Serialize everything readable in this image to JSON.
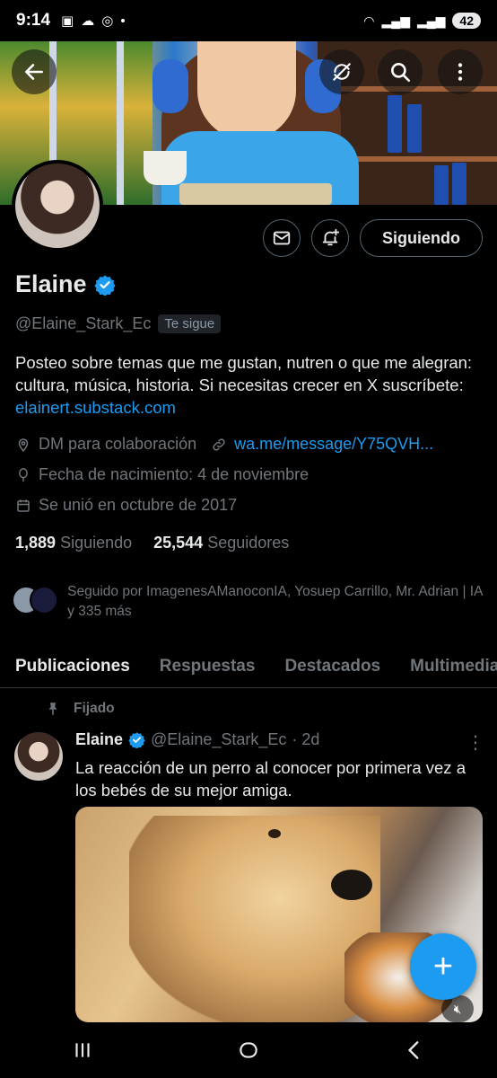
{
  "status_bar": {
    "time": "9:14",
    "battery": "42"
  },
  "profile": {
    "name": "Elaine",
    "handle": "@Elaine_Stark_Ec",
    "follows_you": "Te sigue",
    "follow_button": "Siguiendo",
    "bio_text": "Posteo sobre temas que me gustan, nutren o que me alegran: cultura, música, historia. Si necesitas crecer en X suscríbete: ",
    "bio_link": "elainert.substack.com",
    "location": "DM para colaboración",
    "website": "wa.me/message/Y75QVH...",
    "birthday": "Fecha de nacimiento: 4 de noviembre",
    "joined": "Se unió en octubre de 2017",
    "following_count": "1,889",
    "following_label": "Siguiendo",
    "followers_count": "25,544",
    "followers_label": "Seguidores",
    "followed_by": "Seguido por ImagenesAManoconIA, Yosuep Carrillo, Mr. Adrian | IA y 335 más"
  },
  "tabs": [
    "Publicaciones",
    "Respuestas",
    "Destacados",
    "Multimedia"
  ],
  "post": {
    "pinned_label": "Fijado",
    "author": "Elaine",
    "handle": "@Elaine_Stark_Ec",
    "time": "· 2d",
    "text": "La reacción de un perro al conocer por primera vez a los bebés de su mejor amiga."
  },
  "colors": {
    "accent": "#1d9bf0",
    "background": "#000000",
    "secondary_text": "#71767b"
  },
  "icons": {
    "back": "arrow-left-icon",
    "no_notifications": "refresh-slash-icon",
    "search": "search-icon",
    "more": "more-vertical-icon",
    "message": "mail-icon",
    "notify": "bell-plus-icon",
    "verified": "verified-badge-icon",
    "location": "location-pin-icon",
    "link": "link-icon",
    "birthday": "balloon-icon",
    "calendar": "calendar-icon",
    "pin": "pin-icon",
    "compose": "plus-icon",
    "mute": "mute-icon"
  }
}
